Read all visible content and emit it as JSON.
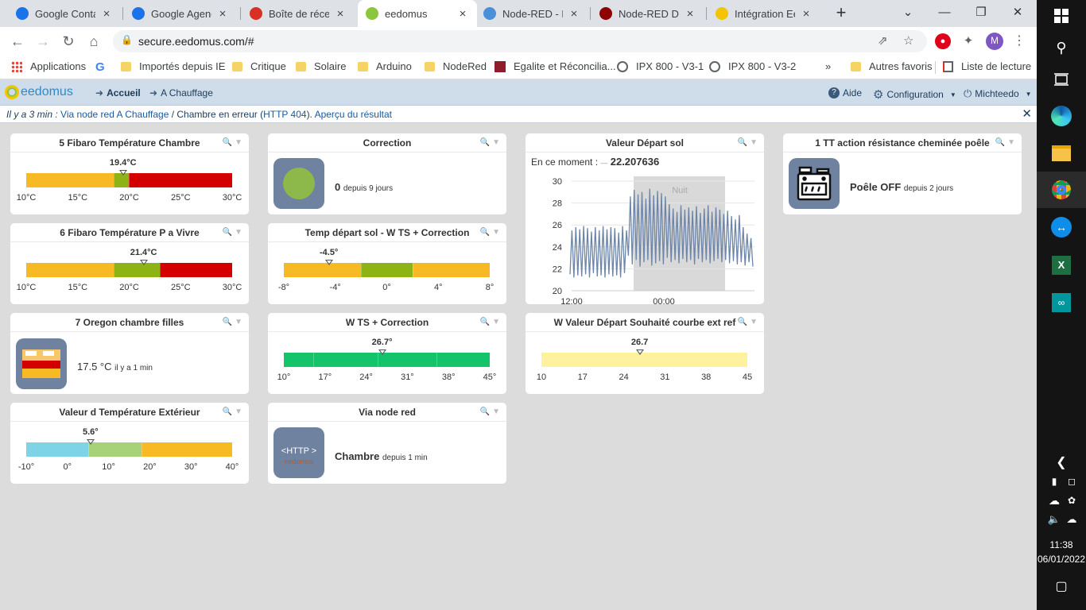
{
  "browser": {
    "tabs": [
      {
        "title": "Google Contacts",
        "favicon": "google-contacts-icon",
        "color": "#1a73e8"
      },
      {
        "title": "Google Agenda",
        "favicon": "google-calendar-icon",
        "color": "#1a73e8"
      },
      {
        "title": "Boîte de réception",
        "favicon": "gmail-icon",
        "color": "#d93025"
      },
      {
        "title": "eedomus",
        "favicon": "eedomus-icon",
        "color": "#8cc63f",
        "active": true
      },
      {
        "title": "Node-RED - Home",
        "favicon": "home-icon",
        "color": "#4a90d9"
      },
      {
        "title": "Node-RED Dashboard",
        "favicon": "node-red-icon",
        "color": "#8f0000"
      },
      {
        "title": "Intégration Eedomus",
        "favicon": "search-icon",
        "color": "#f2c500"
      }
    ],
    "url": "secure.eedomus.com/#",
    "bookmarks": [
      {
        "label": "Applications",
        "type": "apps"
      },
      {
        "label": "",
        "type": "google"
      },
      {
        "label": "Importés depuis IE",
        "type": "folder"
      },
      {
        "label": "Critique",
        "type": "folder"
      },
      {
        "label": "Solaire",
        "type": "folder"
      },
      {
        "label": "Arduino",
        "type": "folder"
      },
      {
        "label": "NodeRed",
        "type": "folder"
      },
      {
        "label": "Egalite et Réconcilia...",
        "type": "site"
      },
      {
        "label": "IPX 800 - V3-1",
        "type": "globe"
      },
      {
        "label": "IPX 800 - V3-2",
        "type": "globe"
      }
    ],
    "more_bookmarks": "»",
    "other_favorites": "Autres favoris",
    "reading_list": "Liste de lecture",
    "profile_initial": "M"
  },
  "app": {
    "logo": "eedomus",
    "nav": {
      "home": "Accueil",
      "room": "A Chauffage"
    },
    "help": "Aide",
    "config": "Configuration",
    "user": "Michteedo"
  },
  "notification": {
    "time": "Il y a 3 min :",
    "link1": "Via node red A Chauffage",
    "text1": " / Chambre en erreur (",
    "link2": "HTTP 404",
    "text2": "). ",
    "link3": "Aperçu du résultat"
  },
  "widgets": {
    "w1": {
      "title": "5 Fibaro Température Chambre",
      "value": "19.4°C",
      "ticks": [
        "10°C",
        "15°C",
        "20°C",
        "25°C",
        "30°C"
      ],
      "min": 10,
      "max": 30,
      "reading": 19.4,
      "zones": [
        {
          "from": 10,
          "to": 18.5,
          "color": "#f7b924"
        },
        {
          "from": 18.5,
          "to": 20,
          "color": "#8db314"
        },
        {
          "from": 20,
          "to": 30,
          "color": "#d40000"
        }
      ]
    },
    "w2": {
      "title": "6 Fibaro Température P a Vivre",
      "value": "21.4°C",
      "ticks": [
        "10°C",
        "15°C",
        "20°C",
        "25°C",
        "30°C"
      ],
      "min": 10,
      "max": 30,
      "reading": 21.4,
      "zones": [
        {
          "from": 10,
          "to": 18.5,
          "color": "#f7b924"
        },
        {
          "from": 18.5,
          "to": 23,
          "color": "#8db314"
        },
        {
          "from": 23,
          "to": 30,
          "color": "#d40000"
        }
      ]
    },
    "w3": {
      "title": "7 Oregon chambre filles",
      "value": "17.5 °C",
      "since": "il y a 1 min",
      "icon": "bed-icon"
    },
    "w4": {
      "title": "Valeur d Température Extérieur",
      "value": "5.6°",
      "ticks": [
        "-10°",
        "0°",
        "10°",
        "20°",
        "30°",
        "40°"
      ],
      "min": -10,
      "max": 40,
      "reading": 5.6,
      "zones": [
        {
          "from": -10,
          "to": 5,
          "color": "#7fd3e6"
        },
        {
          "from": 5,
          "to": 18,
          "color": "#a8d27a"
        },
        {
          "from": 18,
          "to": 40,
          "color": "#f7b924"
        }
      ]
    },
    "w5": {
      "title": "Correction",
      "value": "0",
      "since": "depuis 9 jours",
      "icon": "green-circle-icon"
    },
    "w6": {
      "title": "Temp départ sol - W TS + Correction",
      "value": "-4.5°",
      "ticks": [
        "-8°",
        "-4°",
        "0°",
        "4°",
        "8°"
      ],
      "min": -8,
      "max": 8,
      "reading": -4.5,
      "zones": [
        {
          "from": -8,
          "to": -2,
          "color": "#f7b924"
        },
        {
          "from": -2,
          "to": 2,
          "color": "#8db314"
        },
        {
          "from": 2,
          "to": 8,
          "color": "#f7b924"
        }
      ]
    },
    "w7": {
      "title": "W TS + Correction",
      "value": "26.7°",
      "ticks": [
        "10°",
        "17°",
        "24°",
        "31°",
        "38°",
        "45°"
      ],
      "min": 10,
      "max": 45,
      "reading": 26.7,
      "zones": [
        {
          "from": 10,
          "to": 15,
          "color": "#14c46a"
        },
        {
          "from": 15,
          "to": 26,
          "color": "#14c46a"
        },
        {
          "from": 26,
          "to": 36,
          "color": "#14c46a"
        },
        {
          "from": 36,
          "to": 45,
          "color": "#14c46a"
        }
      ]
    },
    "w8": {
      "title": "Via node red",
      "value": "Chambre",
      "since": "depuis 1 min",
      "icon_text": "<HTTP >",
      "icon_sub": "eedomus"
    },
    "w9": {
      "title": "Valeur Départ sol",
      "moment_label": "En ce moment :",
      "moment_value": "22.207636",
      "night_label": "Nuit",
      "x_labels": [
        "12:00",
        "00:00"
      ],
      "y_labels": [
        "30",
        "28",
        "26",
        "24",
        "22",
        "20"
      ]
    },
    "w10": {
      "title": "W Valeur Départ Souhaité courbe ext ref",
      "value": "26.7",
      "ticks": [
        "10",
        "17",
        "24",
        "31",
        "38",
        "45"
      ],
      "min": 10,
      "max": 45,
      "reading": 26.7,
      "zones": [
        {
          "from": 10,
          "to": 45,
          "color": "#fff29e"
        }
      ]
    },
    "w11": {
      "title": "1 TT action résistance cheminée poêle",
      "value": "Poêle OFF",
      "since": "depuis 2 jours",
      "icon": "stove-icon"
    }
  },
  "chart_data": {
    "type": "line",
    "title": "Valeur Départ sol",
    "x": [
      "12:00",
      "00:00"
    ],
    "ylim": [
      20,
      30
    ],
    "series": [
      {
        "values": [
          21.5,
          25.5,
          21.2,
          25.8,
          21.4,
          25.6,
          21.3,
          25.9,
          21.5,
          25.7,
          21.2,
          25.4,
          21.6,
          25.8,
          21.3,
          25.5,
          21.4,
          25.9,
          21.2,
          25.6,
          21.5,
          25.8,
          21.3,
          25.7,
          21.4,
          25.3,
          21.2,
          25.9,
          21.6,
          25.5,
          23.2,
          28.6,
          22.4,
          29.2,
          22.8,
          28.8,
          22.2,
          29.0,
          22.6,
          28.4,
          22.8,
          29.3,
          22.3,
          28.7,
          22.5,
          29.1,
          22.7,
          28.9,
          22.4,
          28.6,
          23.0,
          27.9,
          22.6,
          27.5,
          22.8,
          27.2,
          22.5,
          27.8,
          22.9,
          27.4,
          22.6,
          27.6,
          22.8,
          27.3,
          22.4,
          27.7,
          22.9,
          27.1,
          22.6,
          27.5,
          22.8,
          27.8,
          22.5,
          27.2,
          22.7,
          27.6,
          22.9,
          27.4,
          22.6,
          27.0,
          22.8,
          27.3,
          22.5,
          26.8,
          22.7,
          26.5,
          22.4,
          26.9,
          22.6,
          25.8,
          22.3,
          25.2,
          22.6,
          24.8,
          22.2
        ]
      }
    ],
    "night_band": [
      "night_start",
      "night_end"
    ]
  },
  "taskbar": {
    "time": "11:38",
    "date": "06/01/2022"
  }
}
